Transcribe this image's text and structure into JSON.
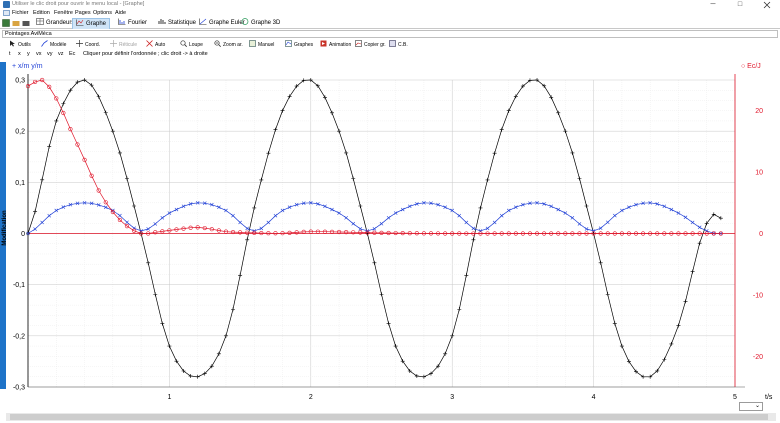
{
  "window": {
    "title": "Utiliser le clic droit pour ouvrir le menu local - [Graphe]",
    "minimize": "─",
    "maximize": "□"
  },
  "menu": [
    "Fichier",
    "Edition",
    "Fenêtre",
    "Pages",
    "Options",
    "Aide"
  ],
  "tabs": [
    {
      "label": "Grandeurs",
      "icon": "table-icon"
    },
    {
      "label": "Graphe",
      "icon": "graph-icon",
      "active": true
    },
    {
      "label": "Fourier",
      "icon": "fourier-icon"
    },
    {
      "label": "Statistique",
      "icon": "statistics-icon"
    },
    {
      "label": "Graphe Euler",
      "icon": "euler-graph-icon"
    },
    {
      "label": "Graphe 3D",
      "icon": "graph-3d-icon"
    }
  ],
  "section_title": "Pointages AviMéca",
  "toolbar": [
    {
      "label": "Outils",
      "icon": "cursor-icon"
    },
    {
      "label": "Modèle",
      "icon": "model-icon"
    },
    {
      "label": "Coord.",
      "icon": "crosshair-icon"
    },
    {
      "label": "Réticule",
      "icon": "reticle-icon",
      "disabled": true
    },
    {
      "label": "Auto",
      "icon": "auto-zoom-icon"
    },
    {
      "label": "Loupe",
      "icon": "magnifier-icon"
    },
    {
      "label": "Zoom ar.",
      "icon": "zoom-out-icon"
    },
    {
      "label": "Manuel",
      "icon": "manual-scale-icon"
    },
    {
      "label": "Graphes",
      "icon": "graphs-icon"
    },
    {
      "label": "Animation",
      "icon": "animation-icon"
    },
    {
      "label": "Copier gr.",
      "icon": "copy-graph-icon"
    },
    {
      "label": "C.B.",
      "icon": "cb-icon"
    }
  ],
  "variables": [
    "t",
    "x",
    "y",
    "vx",
    "vy",
    "vz",
    "Ec"
  ],
  "instruction": "Cliquer pour définir l'ordonnée ; clic droit -> à droite",
  "side_label": "Modification",
  "zoom_select_arrow": "⌄",
  "colors": {
    "black_series": "#000000",
    "blue_series": "#1f3fd6",
    "red_series": "#e0162a",
    "accent": "#1e73c8"
  },
  "chart_data": {
    "type": "line",
    "x_axis": {
      "label": "t/s",
      "range": [
        0,
        5
      ],
      "ticks": [
        "1",
        "2",
        "3",
        "4",
        "5"
      ]
    },
    "y_left": {
      "label": "x/m  y/m",
      "range": [
        -0.3,
        0.3
      ],
      "ticks": [
        "0,3",
        "0,2",
        "0,1",
        "0",
        "-0,1",
        "-0,2",
        "-0,3"
      ]
    },
    "y_right": {
      "label": "Ec/J",
      "range": [
        -25,
        25
      ],
      "ticks": [
        "20",
        "10",
        "0",
        "-10",
        "-20"
      ]
    },
    "grid": true,
    "series": [
      {
        "name": "x/m",
        "axis": "left",
        "color": "#000000",
        "marker": "+",
        "x": [
          0,
          0.2,
          0.4,
          0.6,
          0.8,
          1.0,
          1.2,
          1.4,
          1.6,
          1.8,
          2.0,
          2.2,
          2.4,
          2.6,
          2.8,
          3.0,
          3.2,
          3.4,
          3.6,
          3.8,
          4.0,
          4.2,
          4.4,
          4.6,
          4.8,
          4.9
        ],
        "y": [
          0,
          0.22,
          0.3,
          0.2,
          0,
          -0.22,
          -0.28,
          -0.2,
          0.05,
          0.24,
          0.3,
          0.2,
          0,
          -0.22,
          -0.28,
          -0.2,
          0.05,
          0.24,
          0.3,
          0.2,
          0,
          -0.22,
          -0.28,
          -0.18,
          0.02,
          0.03
        ]
      },
      {
        "name": "y/m",
        "axis": "left",
        "color": "#1f3fd6",
        "marker": "x",
        "x": [
          0,
          0.2,
          0.4,
          0.6,
          0.8,
          1.0,
          1.2,
          1.4,
          1.6,
          1.8,
          2.0,
          2.2,
          2.4,
          2.6,
          2.8,
          3.0,
          3.2,
          3.4,
          3.6,
          3.8,
          4.0,
          4.2,
          4.4,
          4.6,
          4.8,
          4.9
        ],
        "y": [
          0,
          0.045,
          0.06,
          0.045,
          0.005,
          0.04,
          0.06,
          0.045,
          0.005,
          0.045,
          0.06,
          0.04,
          0.005,
          0.04,
          0.06,
          0.045,
          0.005,
          0.045,
          0.06,
          0.04,
          0.005,
          0.045,
          0.06,
          0.04,
          0.005,
          0
        ]
      },
      {
        "name": "Ec/J",
        "axis": "right",
        "color": "#e0162a",
        "marker": "o",
        "x": [
          0,
          0.1,
          0.2,
          0.3,
          0.4,
          0.5,
          0.6,
          0.7,
          0.8,
          0.9,
          1.0,
          1.1,
          1.2,
          1.3,
          1.4,
          1.6,
          1.8,
          2.0,
          2.5,
          3.0,
          3.5,
          4.0,
          4.5,
          4.9
        ],
        "y": [
          24,
          25,
          22,
          17,
          12,
          7,
          3.5,
          1.2,
          0,
          0.2,
          0.5,
          0.8,
          1.0,
          0.7,
          0.3,
          0.1,
          0.05,
          0.3,
          0.1,
          0,
          0,
          0,
          0,
          0
        ]
      }
    ]
  }
}
